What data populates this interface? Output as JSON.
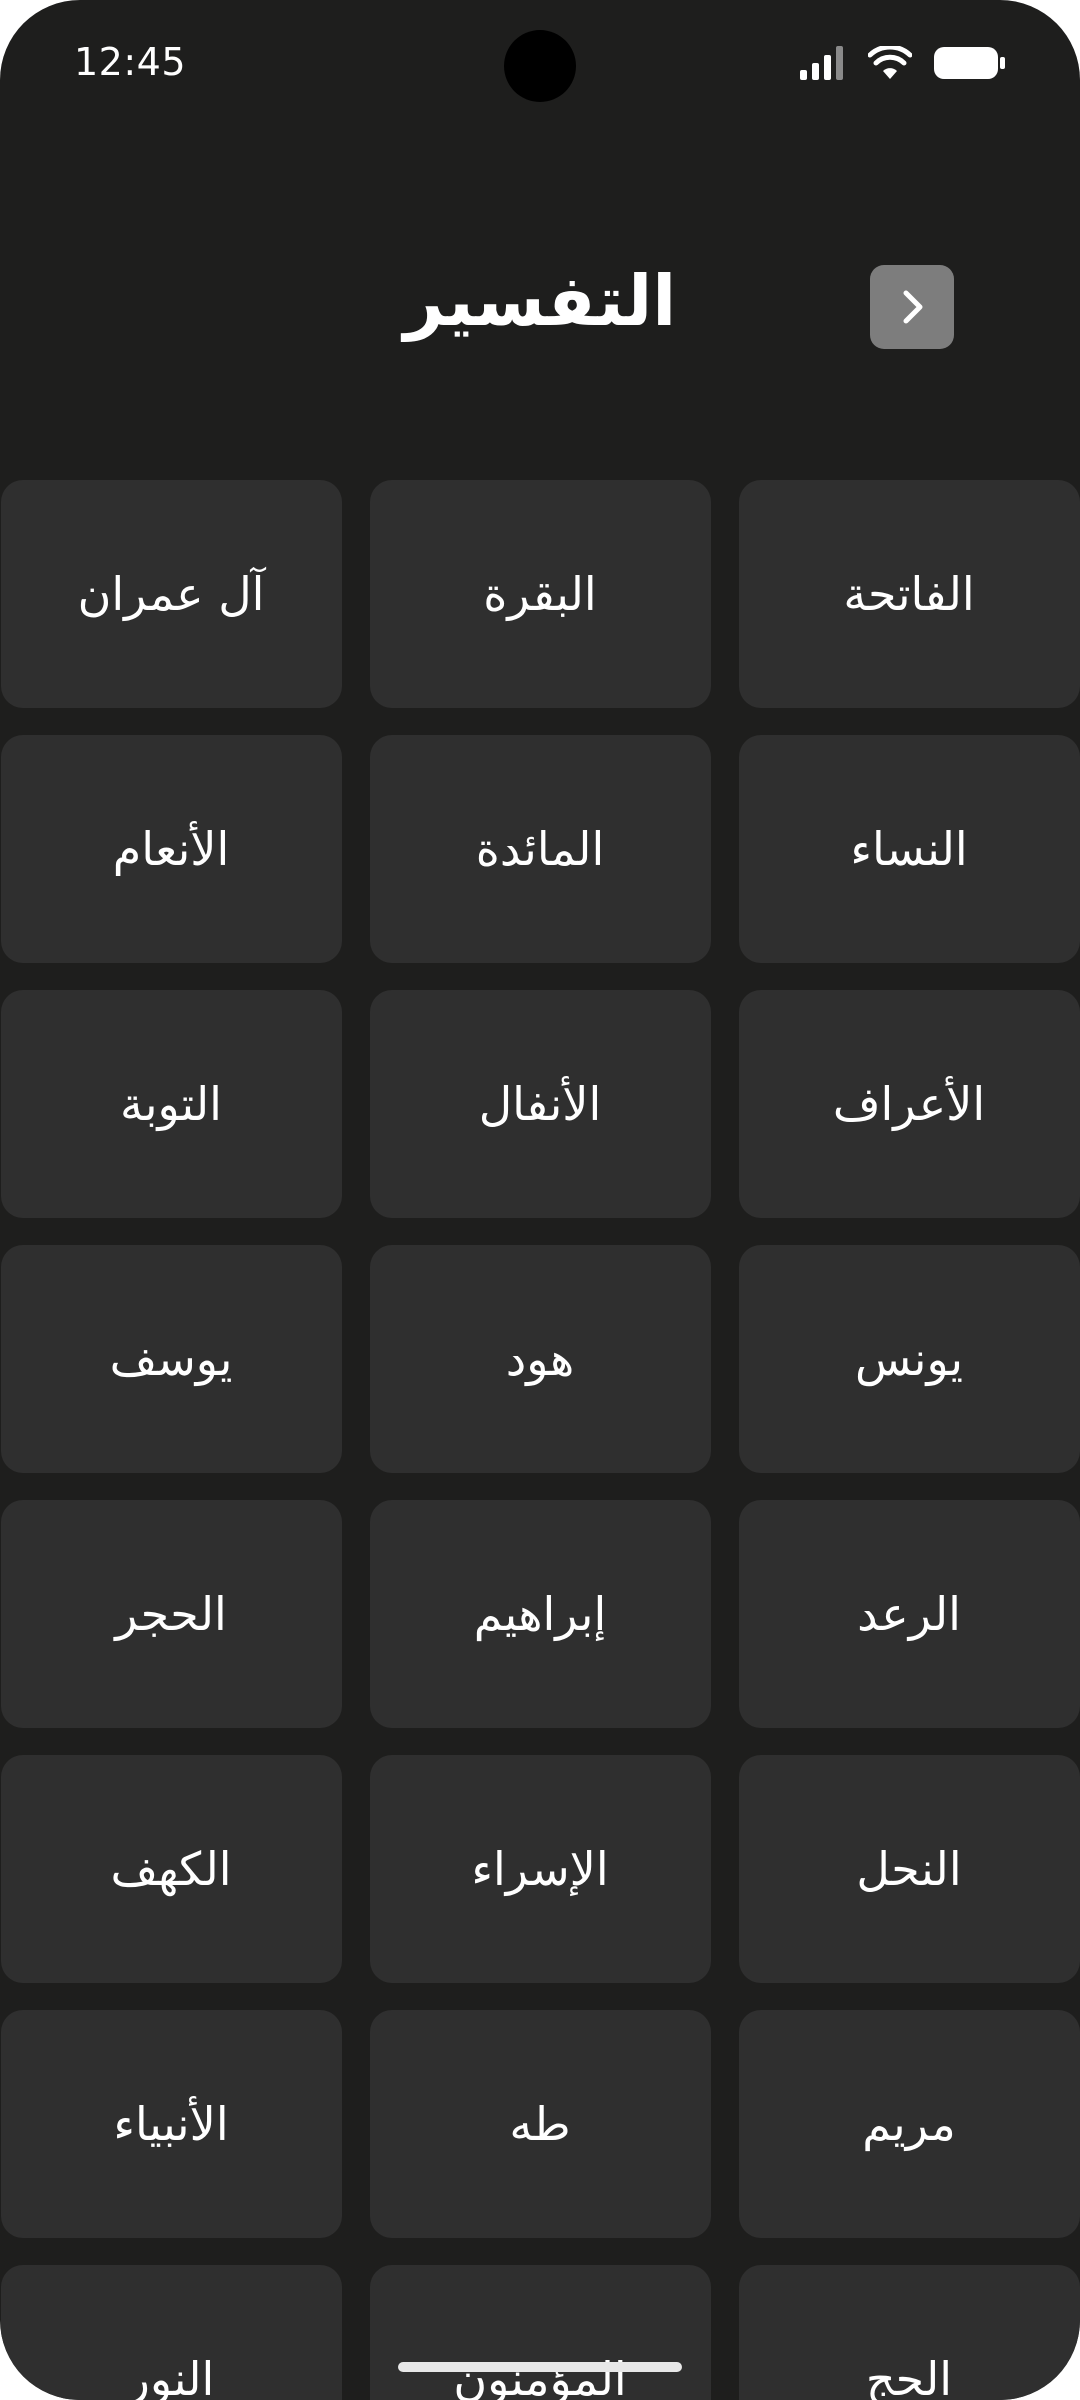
{
  "status_bar": {
    "time": "12:45"
  },
  "header": {
    "title": "التفسير",
    "back_icon": "chevron-right-icon"
  },
  "surahs": [
    "الفاتحة",
    "البقرة",
    "آل عمران",
    "النساء",
    "المائدة",
    "الأنعام",
    "الأعراف",
    "الأنفال",
    "التوبة",
    "يونس",
    "هود",
    "يوسف",
    "الرعد",
    "إبراهيم",
    "الحجر",
    "النحل",
    "الإسراء",
    "الكهف",
    "مريم",
    "طه",
    "الأنبياء",
    "الحج",
    "المؤمنون",
    "النور"
  ],
  "colors": {
    "background": "#1e1e1d",
    "card": "#2f2f2f",
    "back_button": "#7d7d7d",
    "text": "#ffffff"
  }
}
